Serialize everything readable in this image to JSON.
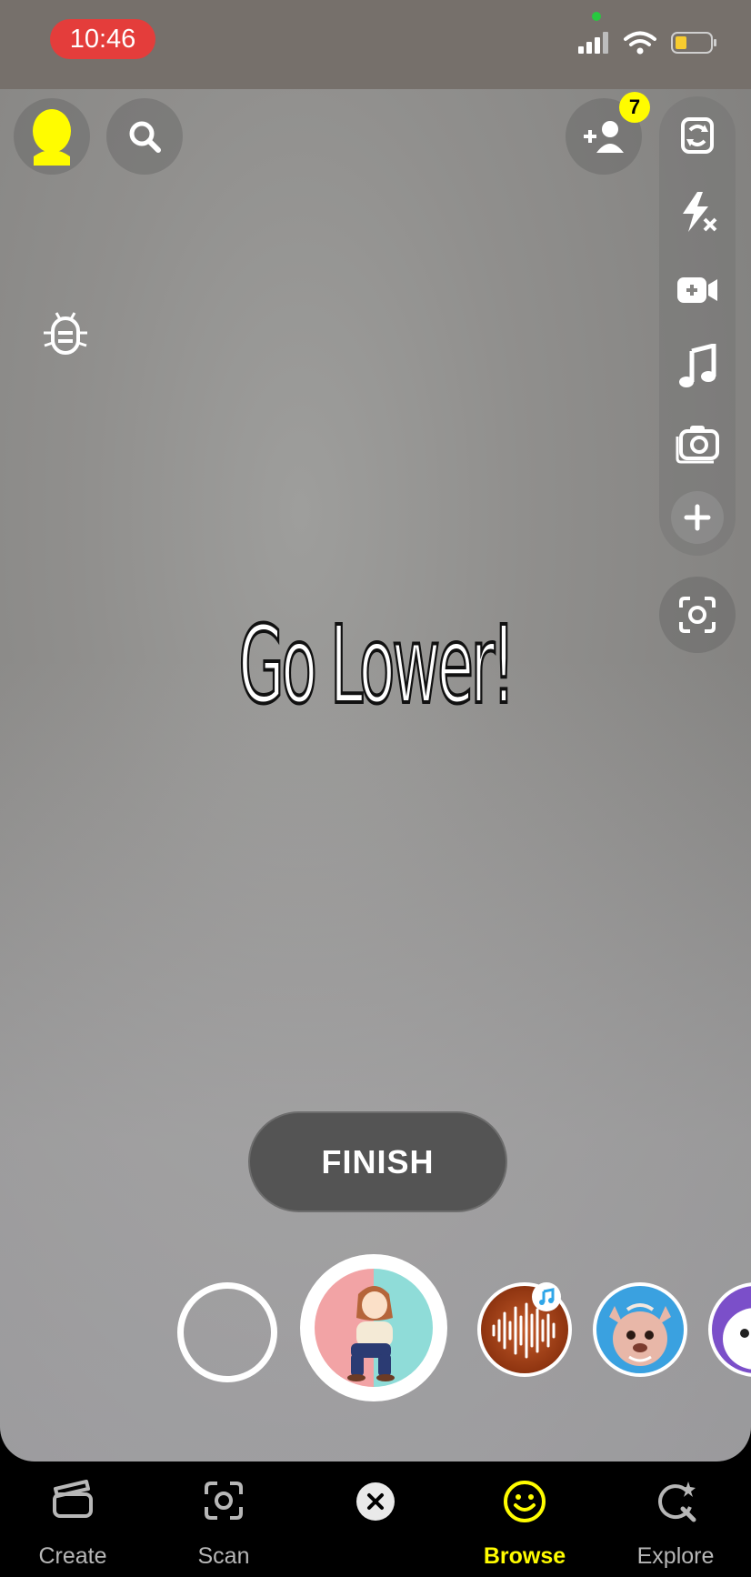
{
  "status_bar": {
    "time": "10:46"
  },
  "top_bar": {
    "friend_requests_count": "7"
  },
  "camera": {
    "headline": "Go Lower!"
  },
  "controls": {
    "finish_label": "FINISH"
  },
  "tab_bar": {
    "tabs": [
      {
        "label": "Create",
        "icon": "clapperboard-icon"
      },
      {
        "label": "Scan",
        "icon": "scan-icon"
      },
      {
        "label": "",
        "icon": "close-icon"
      },
      {
        "label": "Browse",
        "icon": "smiley-icon",
        "active": true
      },
      {
        "label": "Explore",
        "icon": "explore-icon"
      }
    ]
  },
  "colors": {
    "accent": "#fffc00",
    "time_pill": "#e43d3b",
    "finish_button": "#545454"
  }
}
